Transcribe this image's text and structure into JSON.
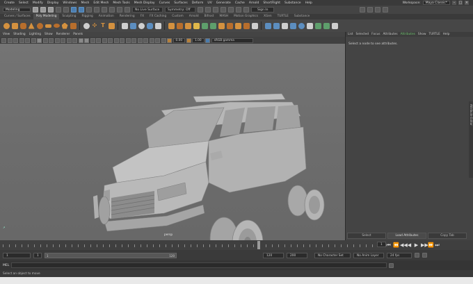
{
  "menubar": {
    "items": [
      "Create",
      "Select",
      "Modify",
      "Display",
      "Windows",
      "Mesh",
      "Edit Mesh",
      "Mesh Tools",
      "Mesh Display",
      "Curves",
      "Surfaces",
      "Deform",
      "UV",
      "Generate",
      "Cache",
      "Arnold",
      "ShortFlight",
      "Substance",
      "Help"
    ],
    "workspace_label": "Workspace:",
    "workspace_value": "Maya Classic*"
  },
  "statusline": {
    "mode": "Modeling",
    "live_surface": "No Live Surface",
    "symmetry": "Symmetry: Off",
    "sign_in": "Sign In"
  },
  "shelf_tabs": [
    "Curves / Surfaces",
    "Poly Modeling",
    "Sculpting",
    "Rigging",
    "Animation",
    "Rendering",
    "FX",
    "FX Caching",
    "Custom",
    "Arnold",
    "Bifrost",
    "MASH",
    "Motion Graphics",
    "XGen",
    "TURTLE",
    "Substance"
  ],
  "shelf_tabs_active": 1,
  "view_menu": [
    "View",
    "Shading",
    "Lighting",
    "Show",
    "Renderer",
    "Panels"
  ],
  "view_tools": {
    "frame_value_1": "0.00",
    "frame_value_2": "1.00",
    "color_space": "sRGB gamma"
  },
  "viewport": {
    "camera_label": "persp"
  },
  "attribute_editor": {
    "tabs": [
      "List",
      "Selected",
      "Focus",
      "Attributes",
      "Show",
      "TURTLE",
      "Help"
    ],
    "active_tab": "Attributes",
    "empty_message": "Select a node to see attributes.",
    "side_label": "Attribute Editor",
    "buttons": [
      "Select",
      "Load Attributes",
      "Copy Tab"
    ]
  },
  "time_slider": {
    "current_frame": "1",
    "playback_buttons": [
      "⏮",
      "⏪",
      "◀◀",
      "◀",
      "▶",
      "▶▶",
      "⏩",
      "⏭"
    ]
  },
  "range_slider": {
    "start": "1",
    "inner_start": "1",
    "inner_end": "120",
    "end": "120",
    "total_end": "200",
    "character_set": "No Character Set",
    "anim_layer": "No Anim Layer",
    "fps": "24 fps"
  },
  "command_line": {
    "label": "MEL"
  },
  "help_line": {
    "text": "Select an object to move"
  },
  "colors": {
    "accent_orange": "#d4913f",
    "accent_blue": "#5c8ec0",
    "active_tab_green": "#6cc06c"
  }
}
